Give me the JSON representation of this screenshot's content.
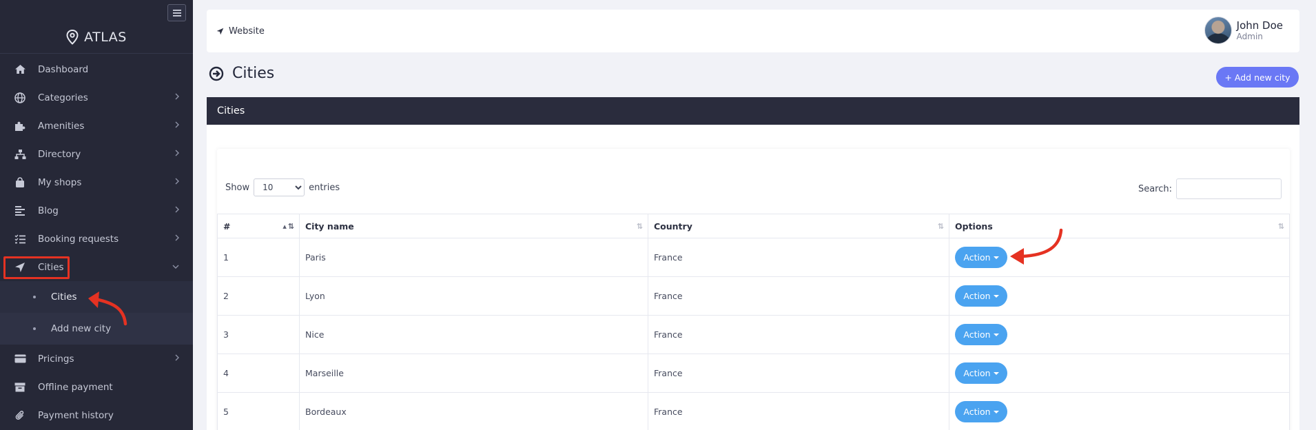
{
  "sidebar": {
    "brand": "ATLAS",
    "items": [
      {
        "label": "Dashboard",
        "icon": "home-icon"
      },
      {
        "label": "Categories",
        "icon": "globe-icon"
      },
      {
        "label": "Amenities",
        "icon": "puzzle-icon"
      },
      {
        "label": "Directory",
        "icon": "sitemap-icon"
      },
      {
        "label": "My shops",
        "icon": "shopping-bag-icon"
      },
      {
        "label": "Blog",
        "icon": "align-left-icon"
      },
      {
        "label": "Booking requests",
        "icon": "tasks-icon"
      },
      {
        "label": "Cities",
        "icon": "location-arrow-icon"
      },
      {
        "label": "Pricings",
        "icon": "credit-card-icon"
      },
      {
        "label": "Offline payment",
        "icon": "archive-icon"
      },
      {
        "label": "Payment history",
        "icon": "paperclip-icon"
      }
    ],
    "cities_submenu": [
      "Cities",
      "Add new city"
    ]
  },
  "topbar": {
    "website_link": "Website",
    "user_name": "John Doe",
    "user_role": "Admin"
  },
  "page": {
    "title": "Cities",
    "add_button": "+ Add new city",
    "card_title": "Cities"
  },
  "table_controls": {
    "show_label": "Show",
    "entries_value": "10",
    "entries_label": "entries",
    "search_label": "Search:"
  },
  "table": {
    "headers": [
      "#",
      "City name",
      "Country",
      "Options"
    ],
    "rows": [
      {
        "id": "1",
        "city": "Paris",
        "country": "France",
        "action": "Action"
      },
      {
        "id": "2",
        "city": "Lyon",
        "country": "France",
        "action": "Action"
      },
      {
        "id": "3",
        "city": "Nice",
        "country": "France",
        "action": "Action"
      },
      {
        "id": "4",
        "city": "Marseille",
        "country": "France",
        "action": "Action"
      },
      {
        "id": "5",
        "city": "Bordeaux",
        "country": "France",
        "action": "Action"
      }
    ]
  },
  "colors": {
    "sidebar_bg": "#262837",
    "card_header_bg": "#2a2c3d",
    "primary_button": "#6a78f5",
    "action_button": "#4aa3f0",
    "annotation_red": "#e53222"
  }
}
